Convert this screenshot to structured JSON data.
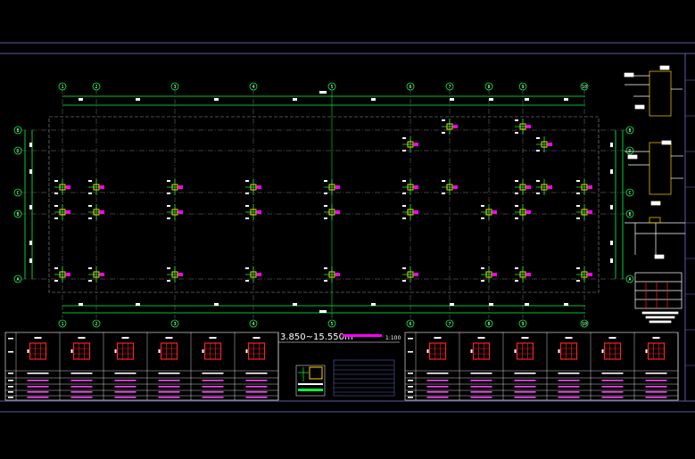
{
  "drawing": {
    "title": "3.850~15.550m",
    "scale": "1:100"
  },
  "axes": {
    "columns": [
      "1",
      "2",
      "3",
      "4",
      "5",
      "6",
      "7",
      "8",
      "9",
      "10"
    ],
    "rows": [
      "B",
      "D",
      "C",
      "B",
      "A"
    ]
  },
  "colors": {
    "background": "#000000",
    "frame": "#5a5aa8",
    "axis_line": "#00ff3c",
    "dashed_line": "#9a9a9a",
    "column_square": "#ffd400",
    "label_tag": "#ff00ff",
    "table_border": "#ffffff",
    "rebar_box": "#ff2020"
  }
}
